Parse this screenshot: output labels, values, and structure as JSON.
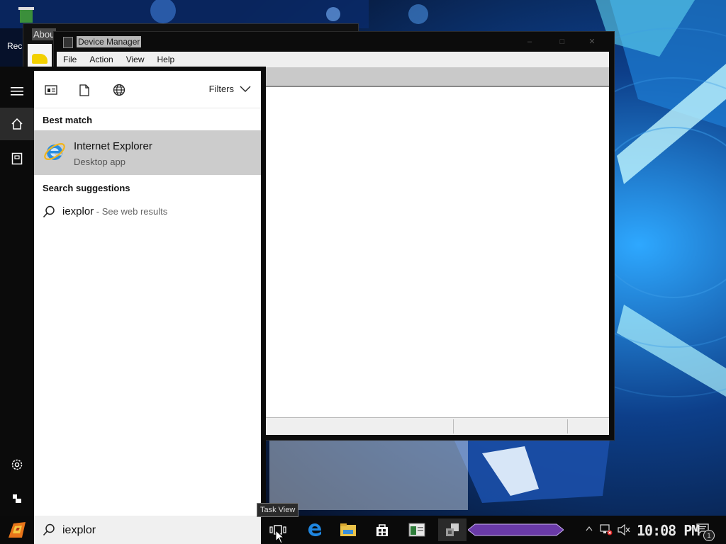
{
  "desktop": {
    "recycle_label": "Rec",
    "background_window_title": "Abou"
  },
  "device_manager": {
    "title": "Device Manager",
    "menu": [
      "File",
      "Action",
      "View",
      "Help"
    ]
  },
  "start_rail": {
    "items": [
      {
        "icon": "hamburger-icon"
      },
      {
        "icon": "home-icon",
        "active": true
      },
      {
        "icon": "documents-icon"
      },
      {
        "icon": "settings-icon"
      },
      {
        "icon": "user-icon"
      }
    ]
  },
  "search_panel": {
    "filter_icons": [
      "apps-filter-icon",
      "documents-filter-icon",
      "web-filter-icon"
    ],
    "filters_label": "Filters",
    "best_match_heading": "Best match",
    "best_match": {
      "name": "Internet Explorer",
      "type": "Desktop app",
      "icon": "internet-explorer-icon"
    },
    "suggestions_heading": "Search suggestions",
    "suggestion": {
      "query": "iexplor",
      "hint": " - See web results"
    }
  },
  "taskbar": {
    "search_value": "iexplor",
    "tooltip": "Task View",
    "clock": "10:08 PM",
    "notification_count": "1",
    "pinned": [
      "task-view-icon",
      "edge-icon",
      "file-explorer-icon",
      "store-icon",
      "app-window-icon",
      "device-manager-icon"
    ],
    "tray": [
      "chevron-up-icon",
      "network-disconnected-icon",
      "volume-muted-icon",
      "notifications-icon"
    ]
  },
  "colors": {
    "search_selected": "#cccccc",
    "taskbar_accent": "#6a3aa8"
  }
}
